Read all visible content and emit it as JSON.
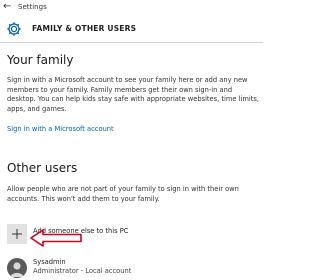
{
  "window": {
    "title": "Settings"
  },
  "header": {
    "title": "FAMILY & OTHER USERS"
  },
  "family": {
    "heading": "Your family",
    "description": "Sign in with a Microsoft account to see your family here or add any new members to your family. Family members get their own sign-in and desktop. You can help kids stay safe with appropriate websites, time limits, apps, and games.",
    "link": "Sign in with a Microsoft account"
  },
  "others": {
    "heading": "Other users",
    "description": "Allow people who are not part of your family to sign in with their own accounts. This won't add them to your family.",
    "add_label": "Add someone else to this PC"
  },
  "user": {
    "name": "Sysadmin",
    "role": "Administrator - Local account"
  },
  "colors": {
    "link": "#0063b1",
    "annotation_arrow": "#d0021b",
    "tile": "#e1e1e1"
  }
}
